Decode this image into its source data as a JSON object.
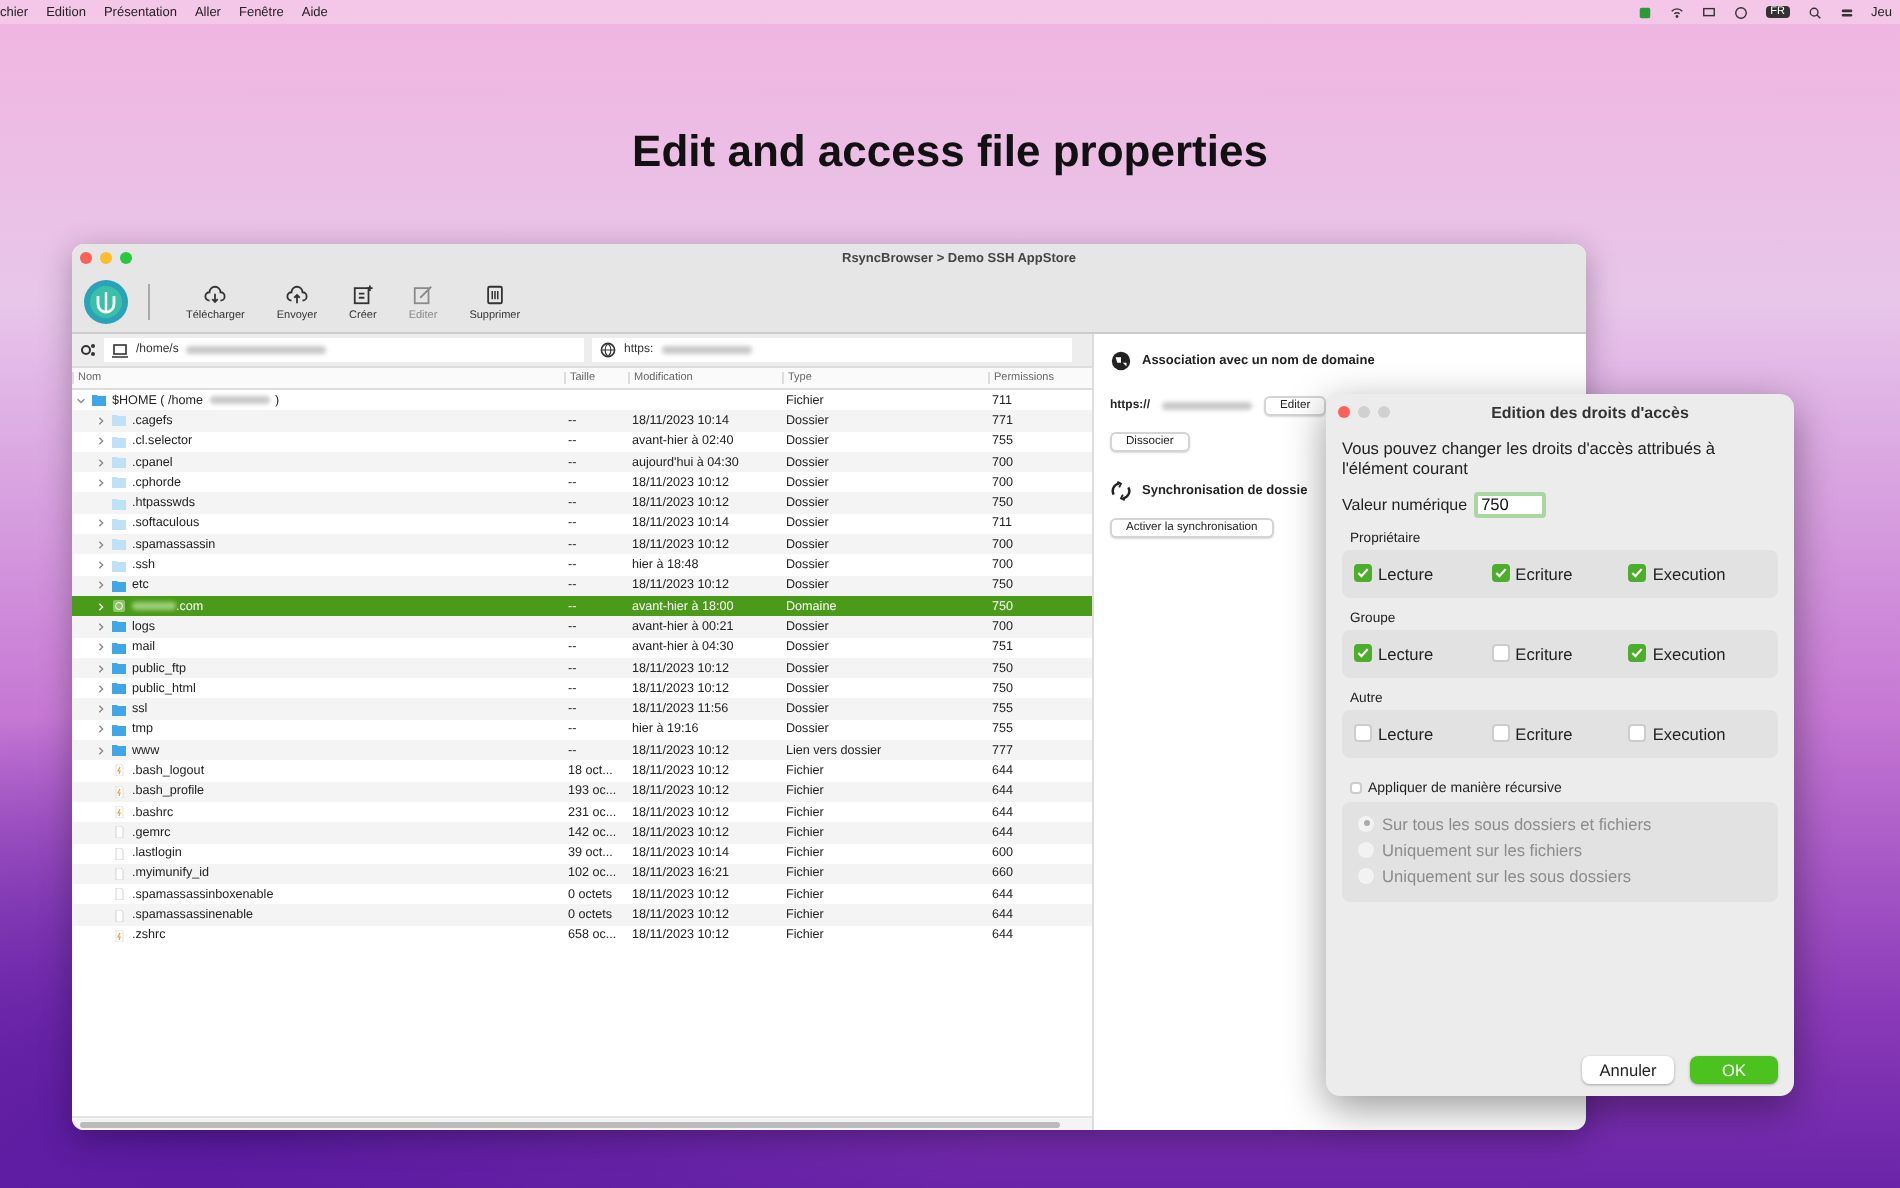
{
  "menu_bar": {
    "items": [
      "chier",
      "Edition",
      "Présentation",
      "Aller",
      "Fenêtre",
      "Aide"
    ],
    "input_badge": "FR",
    "clock": "Jeu"
  },
  "headline": "Edit and access file properties",
  "window": {
    "title": "RsyncBrowser > Demo SSH AppStore",
    "toolbar": [
      {
        "label": "Télécharger",
        "kind": "download",
        "disabled": false
      },
      {
        "label": "Envoyer",
        "kind": "upload",
        "disabled": false
      },
      {
        "label": "Créer",
        "kind": "create",
        "disabled": false
      },
      {
        "label": "Editer",
        "kind": "edit",
        "disabled": true
      },
      {
        "label": "Supprimer",
        "kind": "delete",
        "disabled": false
      }
    ],
    "local_path": "/home/s",
    "remote_path": "https:",
    "file_list": {
      "columns": [
        "Nom",
        "Taille",
        "Modification",
        "Type",
        "Permissions"
      ],
      "root": {
        "name": "$HOME ( /home",
        "name_end": ")",
        "type": "Fichier",
        "permissions": "711",
        "expanded": true,
        "children": [
          {
            "name": ".cagefs",
            "kind": "hidden-folder",
            "expandable": true,
            "size": "--",
            "modified": "18/11/2023 10:14",
            "type": "Dossier",
            "permissions": "771",
            "selected": false
          },
          {
            "name": ".cl.selector",
            "kind": "hidden-folder",
            "expandable": true,
            "size": "--",
            "modified": "avant-hier à 02:40",
            "type": "Dossier",
            "permissions": "755",
            "selected": false
          },
          {
            "name": ".cpanel",
            "kind": "hidden-folder",
            "expandable": true,
            "size": "--",
            "modified": "aujourd'hui à 04:30",
            "type": "Dossier",
            "permissions": "700",
            "selected": false
          },
          {
            "name": ".cphorde",
            "kind": "hidden-folder",
            "expandable": true,
            "size": "--",
            "modified": "18/11/2023 10:12",
            "type": "Dossier",
            "permissions": "700",
            "selected": false
          },
          {
            "name": ".htpasswds",
            "kind": "hidden-folder",
            "expandable": false,
            "size": "--",
            "modified": "18/11/2023 10:12",
            "type": "Dossier",
            "permissions": "750",
            "selected": false
          },
          {
            "name": ".softaculous",
            "kind": "hidden-folder",
            "expandable": true,
            "size": "--",
            "modified": "18/11/2023 10:14",
            "type": "Dossier",
            "permissions": "711",
            "selected": false
          },
          {
            "name": ".spamassassin",
            "kind": "hidden-folder",
            "expandable": true,
            "size": "--",
            "modified": "18/11/2023 10:12",
            "type": "Dossier",
            "permissions": "700",
            "selected": false
          },
          {
            "name": ".ssh",
            "kind": "hidden-folder",
            "expandable": true,
            "size": "--",
            "modified": "hier à 18:48",
            "type": "Dossier",
            "permissions": "700",
            "selected": false
          },
          {
            "name": "etc",
            "kind": "folder",
            "expandable": true,
            "size": "--",
            "modified": "18/11/2023 10:12",
            "type": "Dossier",
            "permissions": "750",
            "selected": false
          },
          {
            "name": ".com",
            "kind": "domain",
            "expandable": true,
            "size": "--",
            "modified": "avant-hier à 18:00",
            "type": "Domaine",
            "permissions": "750",
            "selected": true
          },
          {
            "name": "logs",
            "kind": "folder",
            "expandable": true,
            "size": "--",
            "modified": "avant-hier à 00:21",
            "type": "Dossier",
            "permissions": "700",
            "selected": false
          },
          {
            "name": "mail",
            "kind": "folder",
            "expandable": true,
            "size": "--",
            "modified": "avant-hier à 04:30",
            "type": "Dossier",
            "permissions": "751",
            "selected": false
          },
          {
            "name": "public_ftp",
            "kind": "folder",
            "expandable": true,
            "size": "--",
            "modified": "18/11/2023 10:12",
            "type": "Dossier",
            "permissions": "750",
            "selected": false
          },
          {
            "name": "public_html",
            "kind": "folder",
            "expandable": true,
            "size": "--",
            "modified": "18/11/2023 10:12",
            "type": "Dossier",
            "permissions": "750",
            "selected": false
          },
          {
            "name": "ssl",
            "kind": "folder",
            "expandable": true,
            "size": "--",
            "modified": "18/11/2023 11:56",
            "type": "Dossier",
            "permissions": "755",
            "selected": false
          },
          {
            "name": "tmp",
            "kind": "folder",
            "expandable": true,
            "size": "--",
            "modified": "hier à 19:16",
            "type": "Dossier",
            "permissions": "755",
            "selected": false
          },
          {
            "name": "www",
            "kind": "folder",
            "expandable": true,
            "size": "--",
            "modified": "18/11/2023 10:12",
            "type": "Lien vers dossier",
            "permissions": "777",
            "selected": false
          },
          {
            "name": ".bash_logout",
            "kind": "script",
            "expandable": false,
            "size": "18 oct...",
            "modified": "18/11/2023 10:12",
            "type": "Fichier",
            "permissions": "644",
            "selected": false
          },
          {
            "name": ".bash_profile",
            "kind": "script",
            "expandable": false,
            "size": "193 oc...",
            "modified": "18/11/2023 10:12",
            "type": "Fichier",
            "permissions": "644",
            "selected": false
          },
          {
            "name": ".bashrc",
            "kind": "script",
            "expandable": false,
            "size": "231 oc...",
            "modified": "18/11/2023 10:12",
            "type": "Fichier",
            "permissions": "644",
            "selected": false
          },
          {
            "name": ".gemrc",
            "kind": "file",
            "expandable": false,
            "size": "142 oc...",
            "modified": "18/11/2023 10:12",
            "type": "Fichier",
            "permissions": "644",
            "selected": false
          },
          {
            "name": ".lastlogin",
            "kind": "file",
            "expandable": false,
            "size": "39 oct...",
            "modified": "18/11/2023 10:14",
            "type": "Fichier",
            "permissions": "600",
            "selected": false
          },
          {
            "name": ".myimunify_id",
            "kind": "file",
            "expandable": false,
            "size": "102 oc...",
            "modified": "18/11/2023 16:21",
            "type": "Fichier",
            "permissions": "660",
            "selected": false
          },
          {
            "name": ".spamassassinboxenable",
            "kind": "file",
            "expandable": false,
            "size": "0 octets",
            "modified": "18/11/2023 10:12",
            "type": "Fichier",
            "permissions": "644",
            "selected": false
          },
          {
            "name": ".spamassassinenable",
            "kind": "file",
            "expandable": false,
            "size": "0 octets",
            "modified": "18/11/2023 10:12",
            "type": "Fichier",
            "permissions": "644",
            "selected": false
          },
          {
            "name": ".zshrc",
            "kind": "script",
            "expandable": false,
            "size": "658 oc...",
            "modified": "18/11/2023 10:12",
            "type": "Fichier",
            "permissions": "644",
            "selected": false
          }
        ]
      }
    },
    "side_panel": {
      "domain_title": "Association avec un nom de domaine",
      "domain_url": "https://",
      "edit_button": "Editer",
      "dissociate_button": "Dissocier",
      "sync_title": "Synchronisation de dossie",
      "sync_button": "Activer la synchronisation"
    }
  },
  "dialog": {
    "title": "Edition des droits d'accès",
    "intro": "Vous pouvez changer les droits d'accès attribués à l'élément courant",
    "numeric_label": "Valeur numérique",
    "numeric_value": "750",
    "groups": [
      {
        "title": "Propriétaire",
        "perms": [
          {
            "label": "Lecture",
            "checked": true
          },
          {
            "label": "Ecriture",
            "checked": true
          },
          {
            "label": "Execution",
            "checked": true
          }
        ]
      },
      {
        "title": "Groupe",
        "perms": [
          {
            "label": "Lecture",
            "checked": true
          },
          {
            "label": "Ecriture",
            "checked": false
          },
          {
            "label": "Execution",
            "checked": true
          }
        ]
      },
      {
        "title": "Autre",
        "perms": [
          {
            "label": "Lecture",
            "checked": false
          },
          {
            "label": "Ecriture",
            "checked": false
          },
          {
            "label": "Execution",
            "checked": false
          }
        ]
      }
    ],
    "recursive": {
      "label": "Appliquer de manière récursive",
      "checked": false
    },
    "recursive_options": [
      {
        "label": "Sur tous les sous dossiers et fichiers",
        "selected": true,
        "disabled": true
      },
      {
        "label": "Uniquement sur les fichiers",
        "selected": false,
        "disabled": true
      },
      {
        "label": "Uniquement sur les sous dossiers",
        "selected": false,
        "disabled": true
      }
    ],
    "cancel_button": "Annuler",
    "ok_button": "OK"
  }
}
